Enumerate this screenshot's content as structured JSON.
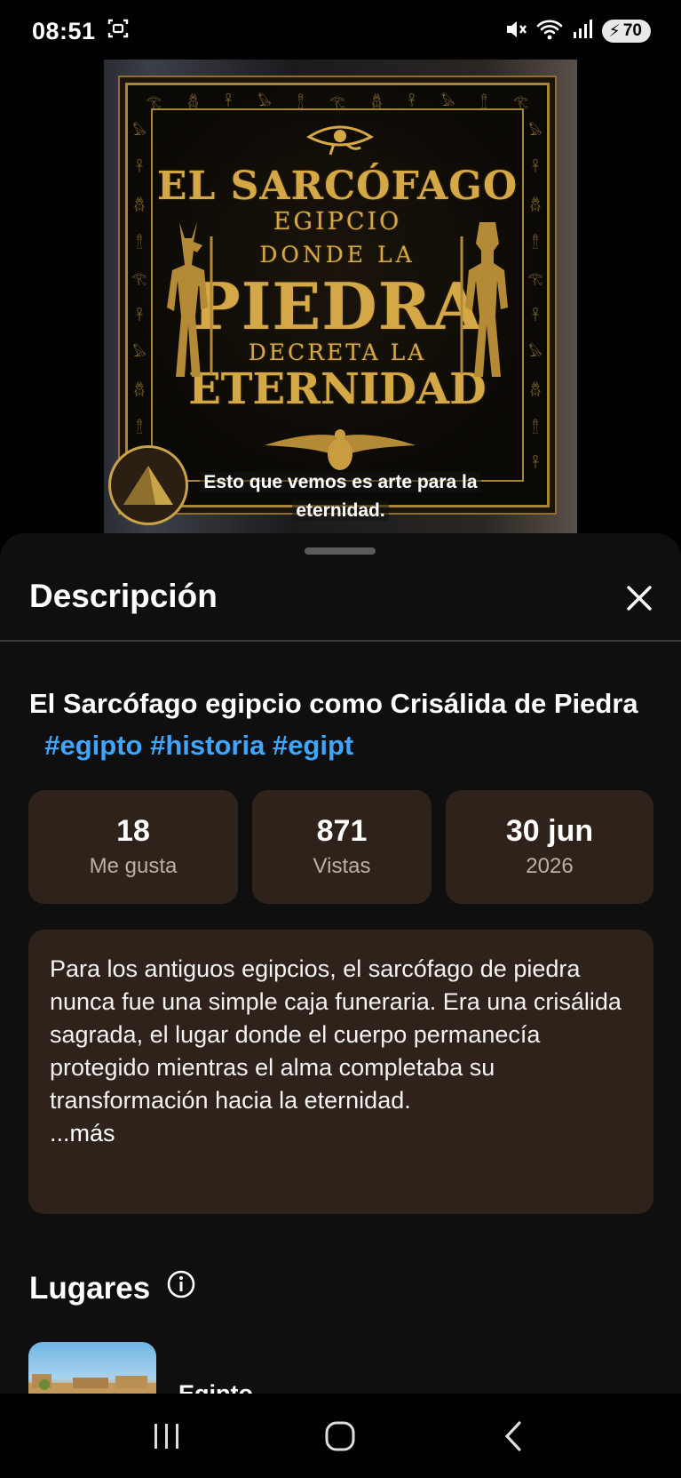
{
  "status_bar": {
    "time": "08:51",
    "battery": "70"
  },
  "video": {
    "poster": {
      "line1": "EL SARCÓFAGO",
      "line2": "EGIPCIO",
      "line3": "DONDE LA",
      "line4": "PIEDRA",
      "line5": "DECRETA LA",
      "line6": "ETERNIDAD"
    },
    "caption_line1": "Esto que vemos es arte para la",
    "caption_line2": "eternidad."
  },
  "sheet": {
    "title": "Descripción",
    "video_title": "El Sarcófago egipcio como Crisálida de Piedra",
    "hashtags": [
      "#egipto",
      "#historia",
      "#egipt"
    ],
    "stats": [
      {
        "value": "18",
        "label": "Me gusta"
      },
      {
        "value": "871",
        "label": "Vistas"
      },
      {
        "value": "30 jun",
        "label": "2026"
      }
    ],
    "description": "Para los antiguos egipcios, el sarcófago de piedra nunca fue una simple caja funeraria. Era una crisálida sagrada, el lugar donde el cuerpo permanecía protegido mientras el alma completaba su transformación hacia la eternidad.",
    "more_label": "...más",
    "places_title": "Lugares",
    "places": [
      {
        "name": "Egipto"
      }
    ]
  },
  "colors": {
    "sheet_bg": "#0f0f0f",
    "card_bg": "#2f221b",
    "hashtag": "#3ea6ff",
    "gold": "#d4a846"
  }
}
